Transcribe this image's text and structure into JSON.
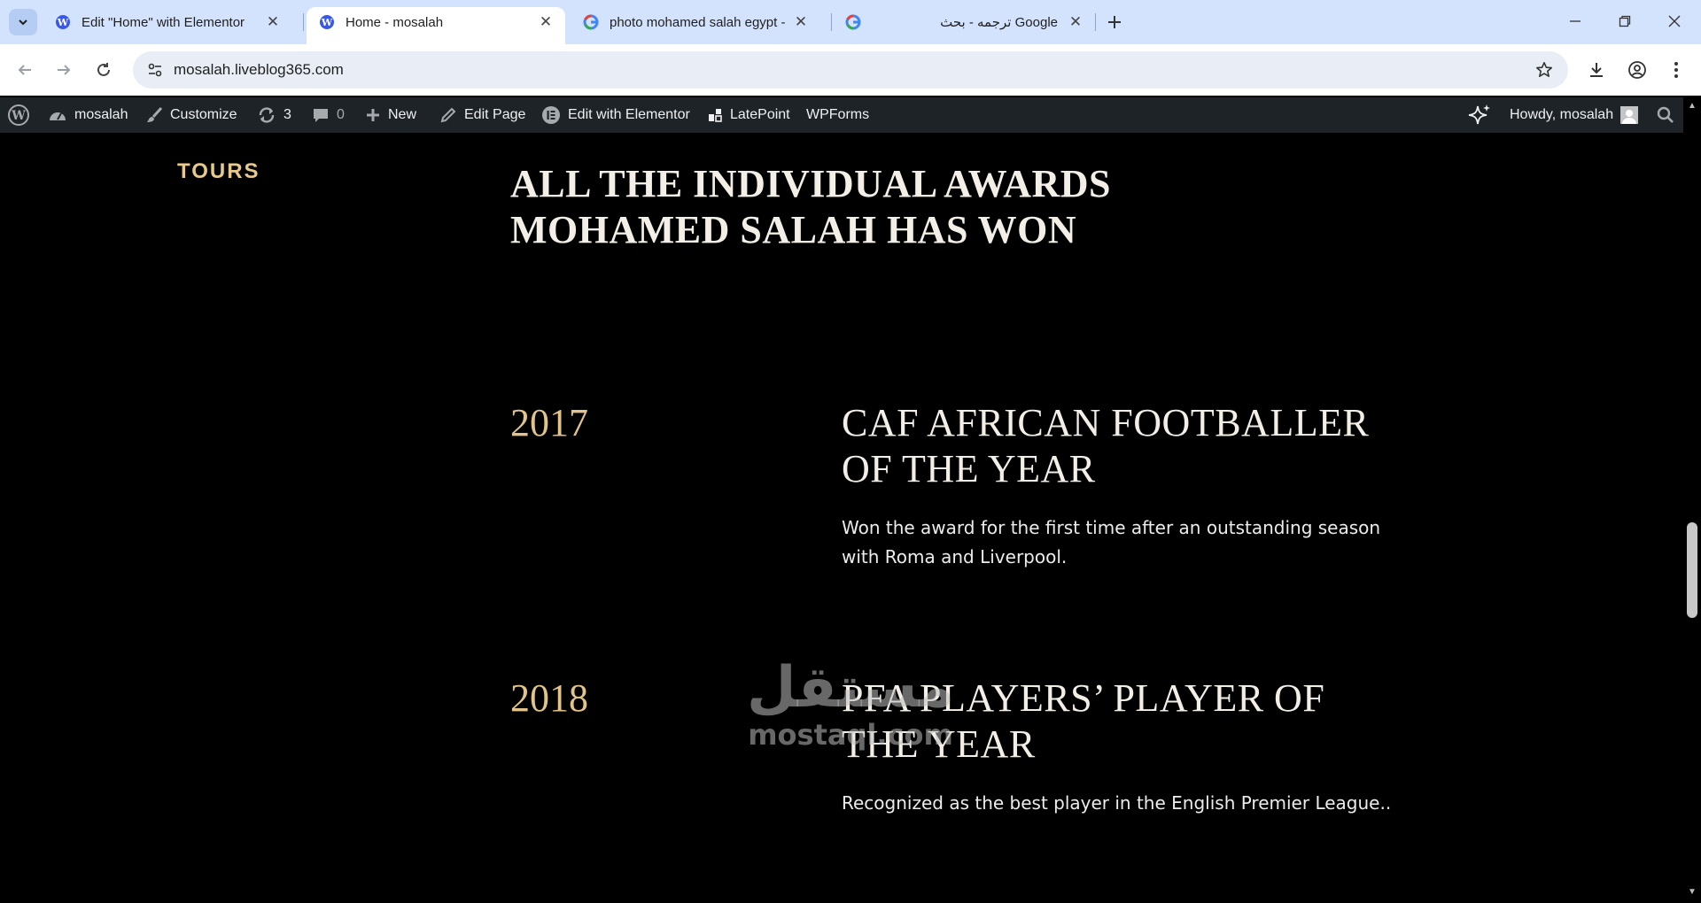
{
  "browser": {
    "tabs": [
      {
        "title": "Edit \"Home\" with Elementor",
        "favicon": "wordpress-icon",
        "active": false
      },
      {
        "title": "Home - mosalah",
        "favicon": "wordpress-icon",
        "active": true
      },
      {
        "title": "photo mohamed salah egypt - ",
        "favicon": "google-icon",
        "active": false
      },
      {
        "title": "ترجمه - بحث Google",
        "favicon": "google-icon",
        "active": false
      }
    ],
    "url": "mosalah.liveblog365.com"
  },
  "admin_bar": {
    "site_name": "mosalah",
    "customize": "Customize",
    "updates_count": "3",
    "comments_count": "0",
    "new": "New",
    "edit_page": "Edit Page",
    "edit_elementor": "Edit with Elementor",
    "latepoint": "LatePoint",
    "wpforms": "WPForms",
    "howdy": "Howdy, mosalah"
  },
  "page": {
    "side_label": "TOURS",
    "section_title": "ALL THE INDIVIDUAL AWARDS MOHAMED SALAH HAS WON",
    "awards": [
      {
        "year": "2017",
        "name": "CAF AFRICAN FOOTBALLER OF THE YEAR",
        "description": "Won the award for the first time after an outstanding season with Roma and Liverpool."
      },
      {
        "year": "2018",
        "name": "PFA PLAYERS’ PLAYER OF THE YEAR",
        "description": "Recognized as the best player in the English Premier League.."
      }
    ]
  },
  "watermark": {
    "arabic": "مستقل",
    "latin": "mostaql.com"
  },
  "colors": {
    "accent_gold": "#e2c48a",
    "admin_bar_bg": "#1d2327",
    "tab_strip_bg": "#d3e3fd"
  }
}
